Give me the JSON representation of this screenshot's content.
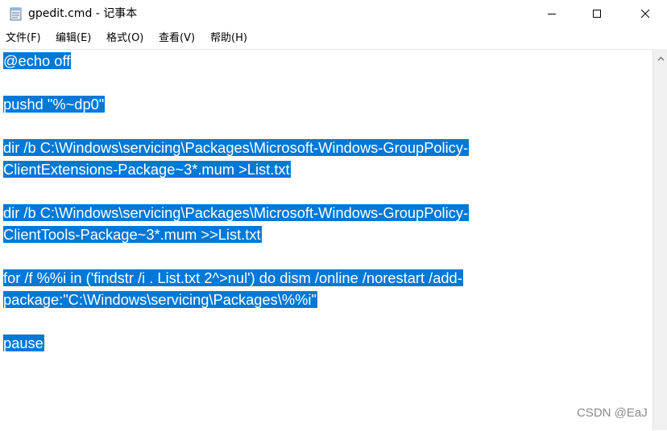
{
  "window": {
    "title": "gpedit.cmd - 记事本",
    "icon": "notepad-icon",
    "controls": {
      "minimize": "minimize-icon",
      "maximize": "maximize-icon",
      "close": "close-icon"
    }
  },
  "menu": {
    "items": [
      "文件(F)",
      "编辑(E)",
      "格式(O)",
      "查看(V)",
      "帮助(H)"
    ]
  },
  "editor": {
    "selection_color": "#0078d7",
    "lines": [
      "@echo off",
      "",
      "pushd \"%~dp0\"",
      "",
      "dir /b C:\\Windows\\servicing\\Packages\\Microsoft-Windows-GroupPolicy-",
      "ClientExtensions-Package~3*.mum >List.txt",
      "",
      "dir /b C:\\Windows\\servicing\\Packages\\Microsoft-Windows-GroupPolicy-",
      "ClientTools-Package~3*.mum >>List.txt",
      "",
      "for /f %%i in ('findstr /i . List.txt 2^>nul') do dism /online /norestart /add-",
      "package:\"C:\\Windows\\servicing\\Packages\\%%i\"",
      "",
      "pause"
    ]
  },
  "watermark": "CSDN @EaJ"
}
